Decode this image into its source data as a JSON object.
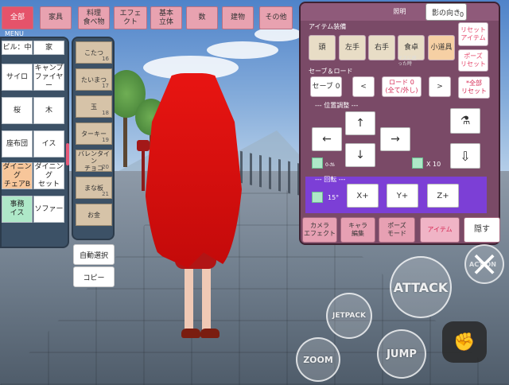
{
  "categories": [
    "全部",
    "家具",
    "料理\n食べ物",
    "エフェ\nクト",
    "基本\n立体",
    "数",
    "建物",
    "その他"
  ],
  "menu_label": "MENU",
  "items_left": [
    "ビル：中",
    "家",
    "サイロ",
    "キャンプ\nファイヤー",
    "桜",
    "木",
    "座布団",
    "イス",
    "ダイニング\nチェアB",
    "ダイニング\nセット",
    "事務\nイス",
    "ソファー"
  ],
  "items_mid": [
    {
      "label": "こたつ",
      "num": "16"
    },
    {
      "label": "たいまつ",
      "num": "17"
    },
    {
      "label": "玉",
      "num": "18"
    },
    {
      "label": "ターキー",
      "num": "19"
    },
    {
      "label": "バレンタイン\nチョコ",
      "num": "20"
    },
    {
      "label": "まな板",
      "num": "21"
    },
    {
      "label": "お金",
      "num": ""
    }
  ],
  "side_buttons": {
    "auto_select": "自動選択",
    "copy": "コピー"
  },
  "right_panel": {
    "title": "照明",
    "shadow_label": "影の向き",
    "shadow_value": "0",
    "section_item": "アイテム装備",
    "slots": [
      "頭",
      "左手",
      "右手",
      "食卓",
      "小道具"
    ],
    "slot_note": "イスに座\nった時",
    "reset_item": "リセット\nアイテム",
    "reset_pose": "ポーズ\nリセット",
    "section_save": "セーブ＆ロード",
    "save": "セーブ 0",
    "prev": "<",
    "load": "ロード 0\n(全て/外し)",
    "next": ">",
    "reset_all": "*全部\nリセット",
    "section_position": "--- 位置調整 ---",
    "up": "↑",
    "down": "↓",
    "left": "←",
    "right": "→",
    "small_label": "0-ｶﾙ",
    "x10_label": "X 10",
    "section_rotate": "--- 回転 ---",
    "angle_label": "15°",
    "x_plus": "X+",
    "y_plus": "Y+",
    "z_plus": "Z+",
    "bottom_tabs": [
      "カメラ\nエフェクト",
      "キャラ\n編集",
      "ポーズ\nモード",
      "アイテム",
      "隠す"
    ]
  },
  "actions": {
    "attack": "ATTACK",
    "jetpack": "JETPACK",
    "zoom": "ZOOM",
    "jump": "JUMP",
    "action": "ACTION"
  },
  "colors": {
    "accent": "#e5536a",
    "panel": "#7a4a67",
    "hair": "#e81512",
    "purple": "#7c3fd6"
  }
}
